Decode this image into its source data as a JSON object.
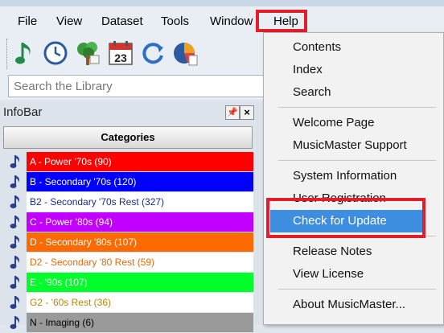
{
  "menubar": {
    "items": [
      "File",
      "View",
      "Dataset",
      "Tools",
      "Window",
      "Help"
    ]
  },
  "search": {
    "placeholder": "Search the Library"
  },
  "infobar": {
    "title": "InfoBar",
    "pin_glyph": "📌",
    "close_glyph": "×",
    "categories_header": "Categories",
    "categories": [
      {
        "label": "A - Power '70s  (90)",
        "bg": "#ff0000",
        "fg": "#ffffff"
      },
      {
        "label": "B - Secondary '70s  (120)",
        "bg": "#0000ff",
        "fg": "#ffffff"
      },
      {
        "label": "B2 - Secondary '70s Rest  (327)",
        "bg": "#ffffff",
        "fg": "#1a2a8a"
      },
      {
        "label": "C - Power '80s  (94)",
        "bg": "#c200ff",
        "fg": "#ffffff"
      },
      {
        "label": "D - Secondary '80s  (107)",
        "bg": "#ff6a00",
        "fg": "#ffffff"
      },
      {
        "label": "D2 - Secondary '80 Rest  (59)",
        "bg": "#ffffff",
        "fg": "#e06a10"
      },
      {
        "label": "E - '90s  (107)",
        "bg": "#00ff2a",
        "fg": "#ffffff"
      },
      {
        "label": "G2 - '60s Rest  (36)",
        "bg": "#ffffff",
        "fg": "#b8860b"
      },
      {
        "label": "N - Imaging  (6)",
        "bg": "#9a9a9a",
        "fg": "#000000"
      }
    ]
  },
  "help_menu": {
    "items": [
      {
        "label": "Contents"
      },
      {
        "label": "Index"
      },
      {
        "label": "Search"
      },
      {
        "label": "Welcome Page"
      },
      {
        "label": "MusicMaster Support"
      },
      {
        "label": "System Information"
      },
      {
        "label": "User Registration"
      },
      {
        "label": "Check for Update",
        "highlighted": true
      },
      {
        "label": "Release Notes"
      },
      {
        "label": "View License"
      },
      {
        "label": "About MusicMaster..."
      }
    ]
  },
  "colors": {
    "annotation_red": "#e01f2a",
    "menu_highlight": "#3d8ee0"
  },
  "toolbar": {
    "icons": [
      "music-note-icon",
      "clock-icon",
      "tree-icon",
      "calendar-icon",
      "refresh-icon",
      "pie-chart-icon"
    ],
    "calendar_day": "23"
  }
}
